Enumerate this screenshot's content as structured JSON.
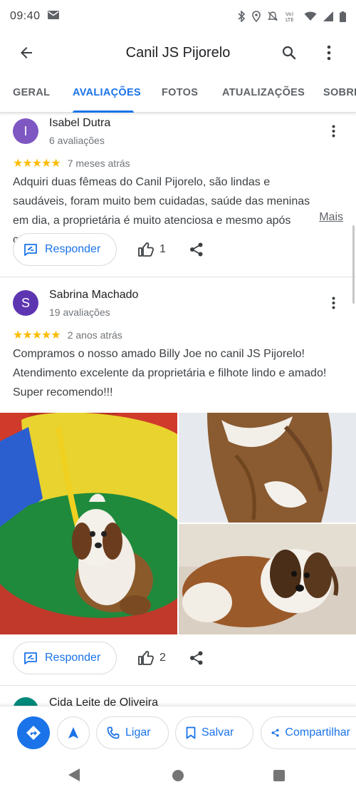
{
  "status_bar": {
    "time": "09:40"
  },
  "app_bar": {
    "title": "Canil JS Pijorelo"
  },
  "tabs": [
    {
      "label": "GERAL",
      "active": false
    },
    {
      "label": "AVALIAÇÕES",
      "active": true
    },
    {
      "label": "FOTOS",
      "active": false
    },
    {
      "label": "ATUALIZAÇÕES",
      "active": false
    },
    {
      "label": "SOBRE",
      "active": false
    }
  ],
  "reviews": [
    {
      "initial": "I",
      "avatar_color": "#7e57c2",
      "name": "Isabel Dutra",
      "review_count": "6 avaliações",
      "stars": "★★★★★",
      "time": "7 meses atrás",
      "text": "Adquiri duas fêmeas do Canil Pijorelo, são lindas e saudáveis, foram muito bem cuidadas, saúde das meninas em dia,  a proprietária é muito atenciosa e mesmo após compra n…",
      "more_label": "Mais",
      "reply_label": "Responder",
      "likes": "1"
    },
    {
      "initial": "S",
      "avatar_color": "#5e35b1",
      "name": "Sabrina Machado",
      "review_count": "19 avaliações",
      "stars": "★★★★★",
      "time": "2 anos atrás",
      "text": "Compramos o nosso amado Billy Joe no canil JS Pijorelo! Atendimento excelente  da proprietária e filhote lindo e amado! Super recomendo!!!",
      "reply_label": "Responder",
      "likes": "2"
    },
    {
      "initial": "",
      "avatar_color": "#00897b",
      "name": "Cida Leite de Oliveira"
    }
  ],
  "action_bar": {
    "call_label": "Ligar",
    "save_label": "Salvar",
    "share_label": "Compartilhar"
  },
  "colors": {
    "accent": "#1a73e8",
    "star": "#fbbc04"
  }
}
